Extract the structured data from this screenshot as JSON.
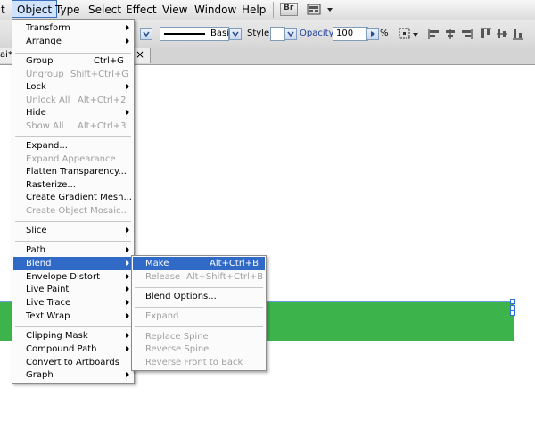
{
  "menubar": {
    "items": [
      "t",
      "Object",
      "Type",
      "Select",
      "Effect",
      "View",
      "Window",
      "Help"
    ],
    "br_label": "Br"
  },
  "control_bar": {
    "stroke_style": "Basic",
    "style_label": "Style:",
    "opacity_label": "Opacity:",
    "opacity_value": "100",
    "opacity_unit": "%"
  },
  "document_tab": {
    "label": "ai*"
  },
  "object_menu": {
    "items": [
      {
        "label": "Transform",
        "shortcut": "",
        "submenu": true,
        "enabled": true
      },
      {
        "label": "Arrange",
        "shortcut": "",
        "submenu": true,
        "enabled": true
      },
      {
        "label": "Group",
        "shortcut": "Ctrl+G",
        "submenu": false,
        "enabled": true
      },
      {
        "label": "Ungroup",
        "shortcut": "Shift+Ctrl+G",
        "submenu": false,
        "enabled": false
      },
      {
        "label": "Lock",
        "shortcut": "",
        "submenu": true,
        "enabled": true
      },
      {
        "label": "Unlock All",
        "shortcut": "Alt+Ctrl+2",
        "submenu": false,
        "enabled": false
      },
      {
        "label": "Hide",
        "shortcut": "",
        "submenu": true,
        "enabled": true
      },
      {
        "label": "Show All",
        "shortcut": "Alt+Ctrl+3",
        "submenu": false,
        "enabled": false
      },
      {
        "label": "Expand...",
        "shortcut": "",
        "submenu": false,
        "enabled": true
      },
      {
        "label": "Expand Appearance",
        "shortcut": "",
        "submenu": false,
        "enabled": false
      },
      {
        "label": "Flatten Transparency...",
        "shortcut": "",
        "submenu": false,
        "enabled": true
      },
      {
        "label": "Rasterize...",
        "shortcut": "",
        "submenu": false,
        "enabled": true
      },
      {
        "label": "Create Gradient Mesh...",
        "shortcut": "",
        "submenu": false,
        "enabled": true
      },
      {
        "label": "Create Object Mosaic...",
        "shortcut": "",
        "submenu": false,
        "enabled": false
      },
      {
        "label": "Slice",
        "shortcut": "",
        "submenu": true,
        "enabled": true
      },
      {
        "label": "Path",
        "shortcut": "",
        "submenu": true,
        "enabled": true
      },
      {
        "label": "Blend",
        "shortcut": "",
        "submenu": true,
        "enabled": true,
        "highlighted": true
      },
      {
        "label": "Envelope Distort",
        "shortcut": "",
        "submenu": true,
        "enabled": true
      },
      {
        "label": "Live Paint",
        "shortcut": "",
        "submenu": true,
        "enabled": true
      },
      {
        "label": "Live Trace",
        "shortcut": "",
        "submenu": true,
        "enabled": true
      },
      {
        "label": "Text Wrap",
        "shortcut": "",
        "submenu": true,
        "enabled": true
      },
      {
        "label": "Clipping Mask",
        "shortcut": "",
        "submenu": true,
        "enabled": true
      },
      {
        "label": "Compound Path",
        "shortcut": "",
        "submenu": true,
        "enabled": true
      },
      {
        "label": "Convert to Artboards",
        "shortcut": "",
        "submenu": false,
        "enabled": true
      },
      {
        "label": "Graph",
        "shortcut": "",
        "submenu": true,
        "enabled": true
      }
    ]
  },
  "blend_menu": {
    "items": [
      {
        "label": "Make",
        "shortcut": "Alt+Ctrl+B",
        "enabled": true,
        "highlighted": true
      },
      {
        "label": "Release",
        "shortcut": "Alt+Shift+Ctrl+B",
        "enabled": false
      },
      {
        "label": "Blend Options...",
        "shortcut": "",
        "enabled": true
      },
      {
        "label": "Expand",
        "shortcut": "",
        "enabled": false
      },
      {
        "label": "Replace Spine",
        "shortcut": "",
        "enabled": false
      },
      {
        "label": "Reverse Spine",
        "shortcut": "",
        "enabled": false
      },
      {
        "label": "Reverse Front to Back",
        "shortcut": "",
        "enabled": false
      }
    ]
  },
  "colors": {
    "highlight": "#3169c6",
    "object_fill": "#3cb44b",
    "selection": "#2d6fd6"
  }
}
